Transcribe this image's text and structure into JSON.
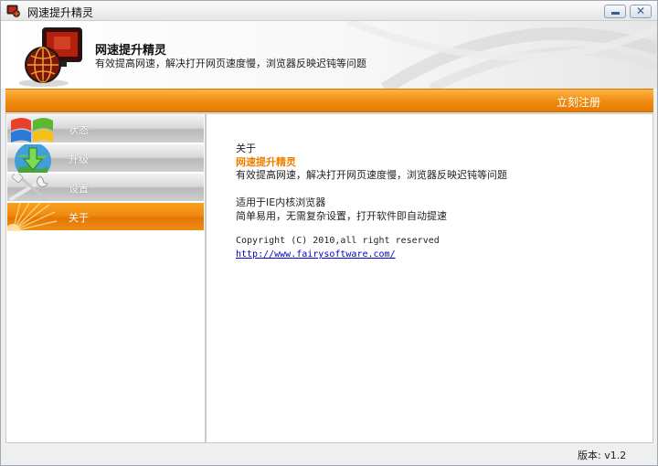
{
  "window": {
    "title": "网速提升精灵"
  },
  "header": {
    "title": "网速提升精灵",
    "subtitle": "有效提高网速，解决打开网页速度慢，浏览器反映迟钝等问题"
  },
  "toolbar": {
    "register_label": "立刻注册"
  },
  "sidebar": {
    "items": [
      {
        "label": "状态",
        "icon": "windows-logo-icon",
        "active": false
      },
      {
        "label": "升级",
        "icon": "globe-download-icon",
        "active": false
      },
      {
        "label": "设置",
        "icon": "wrench-screwdriver-icon",
        "active": false
      },
      {
        "label": "关于",
        "icon": "sunburst-icon",
        "active": true
      }
    ]
  },
  "about": {
    "heading": "关于",
    "product_name": "网速提升精灵",
    "description": "有效提高网速，解决打开网页速度慢，浏览器反映迟钝等问题",
    "compatibility": "适用于IE内核浏览器",
    "usage": "简单易用，无需复杂设置，打开软件即自动提速",
    "copyright": "Copyright (C) 2010,all right reserved",
    "website": "http://www.fairysoftware.com/"
  },
  "status": {
    "version": "版本: v1.2"
  },
  "colors": {
    "accent": "#f08a10",
    "link": "#0000cc",
    "product_name": "#f08000"
  }
}
